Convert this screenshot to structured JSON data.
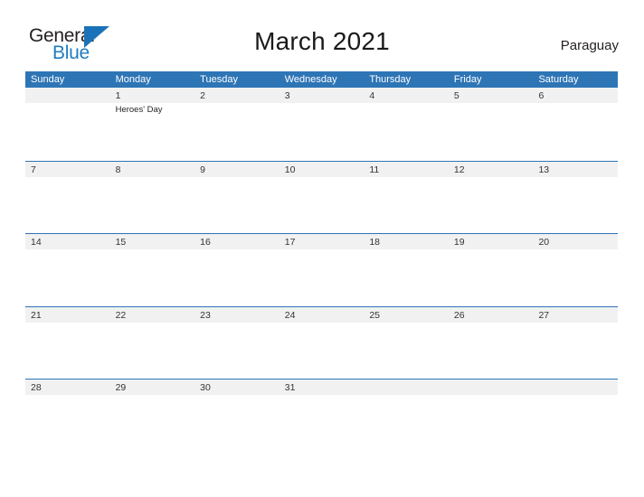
{
  "logo": {
    "text_primary": "General",
    "text_secondary": "Blue",
    "triangle_icon": "triangle-icon",
    "color_primary": "#231f20",
    "color_secondary": "#1f7cc2",
    "color_triangle": "#1b72b8"
  },
  "header": {
    "title": "March 2021",
    "country": "Paraguay"
  },
  "theme": {
    "header_blue": "#2e75b6",
    "row_line_blue": "#2e75b6",
    "daynum_band_gray": "#f1f1f1",
    "text_dark": "#333333",
    "page_background": "#ffffff"
  },
  "calendar": {
    "month": "March",
    "year": "2021",
    "weekday_headers": [
      "Sunday",
      "Monday",
      "Tuesday",
      "Wednesday",
      "Thursday",
      "Friday",
      "Saturday"
    ],
    "weeks": [
      [
        {
          "day": "",
          "event": ""
        },
        {
          "day": "1",
          "event": "Heroes' Day"
        },
        {
          "day": "2",
          "event": ""
        },
        {
          "day": "3",
          "event": ""
        },
        {
          "day": "4",
          "event": ""
        },
        {
          "day": "5",
          "event": ""
        },
        {
          "day": "6",
          "event": ""
        }
      ],
      [
        {
          "day": "7",
          "event": ""
        },
        {
          "day": "8",
          "event": ""
        },
        {
          "day": "9",
          "event": ""
        },
        {
          "day": "10",
          "event": ""
        },
        {
          "day": "11",
          "event": ""
        },
        {
          "day": "12",
          "event": ""
        },
        {
          "day": "13",
          "event": ""
        }
      ],
      [
        {
          "day": "14",
          "event": ""
        },
        {
          "day": "15",
          "event": ""
        },
        {
          "day": "16",
          "event": ""
        },
        {
          "day": "17",
          "event": ""
        },
        {
          "day": "18",
          "event": ""
        },
        {
          "day": "19",
          "event": ""
        },
        {
          "day": "20",
          "event": ""
        }
      ],
      [
        {
          "day": "21",
          "event": ""
        },
        {
          "day": "22",
          "event": ""
        },
        {
          "day": "23",
          "event": ""
        },
        {
          "day": "24",
          "event": ""
        },
        {
          "day": "25",
          "event": ""
        },
        {
          "day": "26",
          "event": ""
        },
        {
          "day": "27",
          "event": ""
        }
      ],
      [
        {
          "day": "28",
          "event": ""
        },
        {
          "day": "29",
          "event": ""
        },
        {
          "day": "30",
          "event": ""
        },
        {
          "day": "31",
          "event": ""
        },
        {
          "day": "",
          "event": ""
        },
        {
          "day": "",
          "event": ""
        },
        {
          "day": "",
          "event": ""
        }
      ]
    ]
  }
}
